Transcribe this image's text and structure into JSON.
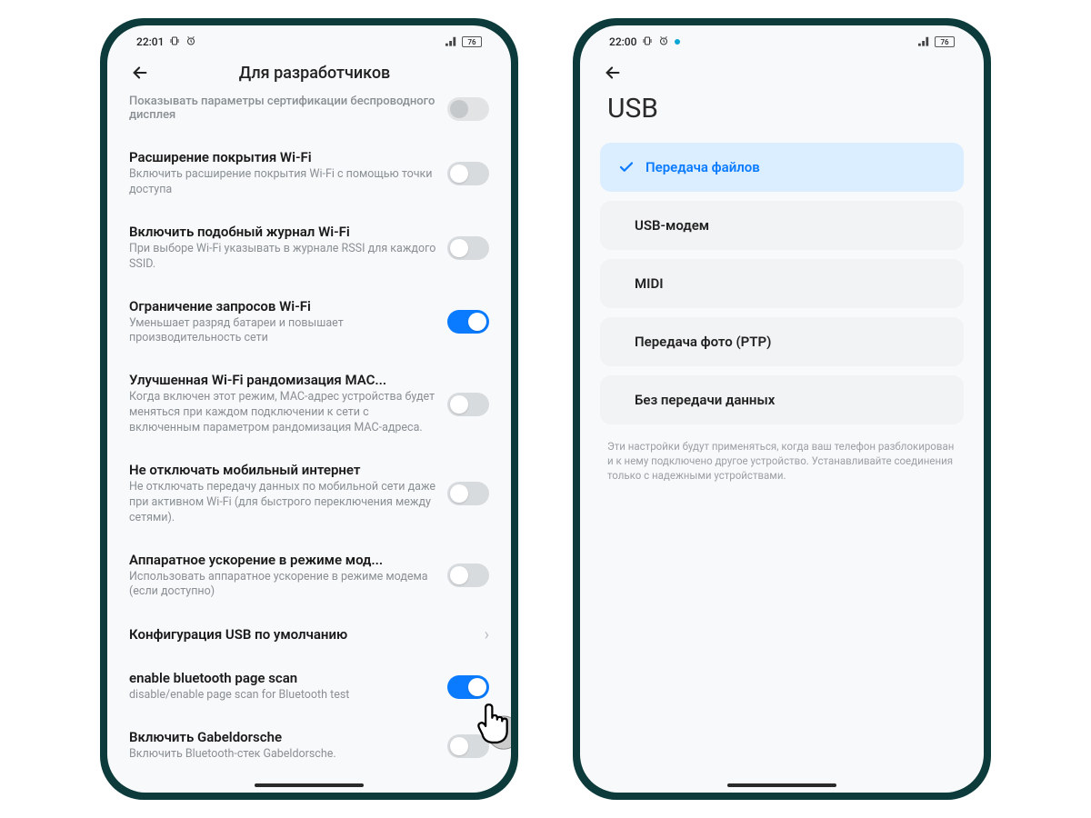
{
  "phone1": {
    "status": {
      "time": "22:01",
      "battery": "76"
    },
    "header": {
      "title": "Для разработчиков"
    },
    "rows": [
      {
        "title": "Показывать параметры сертификации беспроводного дисплея",
        "sub": "",
        "toggle": "off-dim",
        "faded": true
      },
      {
        "title": "Расширение покрытия Wi-Fi",
        "sub": "Включить расширение покрытия Wi-Fi с помощью точки доступа",
        "toggle": "off"
      },
      {
        "title": "Включить подобный журнал Wi-Fi",
        "sub": "При выборе Wi-Fi указывать в журнале RSSI для каждого SSID.",
        "toggle": "off"
      },
      {
        "title": "Ограничение запросов Wi-Fi",
        "sub": "Уменьшает разряд батареи и повышает производительность сети",
        "toggle": "on"
      },
      {
        "title": "Улучшенная Wi-Fi рандомизация MAC...",
        "sub": "Когда включен этот режим, MAC-адрес устройства будет меняться при каждом подключении к сети с включенным параметром рандомизация MAC-адреса.",
        "toggle": "off"
      },
      {
        "title": "Не отключать мобильный интернет",
        "sub": "Не отключать передачу данных по мобильной сети даже при активном Wi-Fi (для быстрого переключения между сетями).",
        "toggle": "off"
      },
      {
        "title": "Аппаратное ускорение в режиме мод...",
        "sub": "Использовать аппаратное ускорение в режиме модема (если доступно)",
        "toggle": "off"
      },
      {
        "title": "Конфигурация USB по умолчанию",
        "sub": "",
        "chevron": true
      },
      {
        "title": "enable bluetooth page scan",
        "sub": "disable/enable page scan for Bluetooth test",
        "toggle": "on"
      },
      {
        "title": "Включить Gabeldorsche",
        "sub": "Включить Bluetooth-стек Gabeldorsche.",
        "toggle": "off"
      }
    ]
  },
  "phone2": {
    "status": {
      "time": "22:00",
      "battery": "76"
    },
    "title": "USB",
    "options": [
      {
        "label": "Передача файлов",
        "selected": true
      },
      {
        "label": "USB-модем",
        "selected": false
      },
      {
        "label": "MIDI",
        "selected": false
      },
      {
        "label": "Передача фото (PTP)",
        "selected": false
      },
      {
        "label": "Без передачи данных",
        "selected": false
      }
    ],
    "footnote": "Эти настройки будут применяться, когда ваш телефон разблокирован и к нему подключено другое устройство. Устанавливайте соединения только с надежными устройствами."
  }
}
